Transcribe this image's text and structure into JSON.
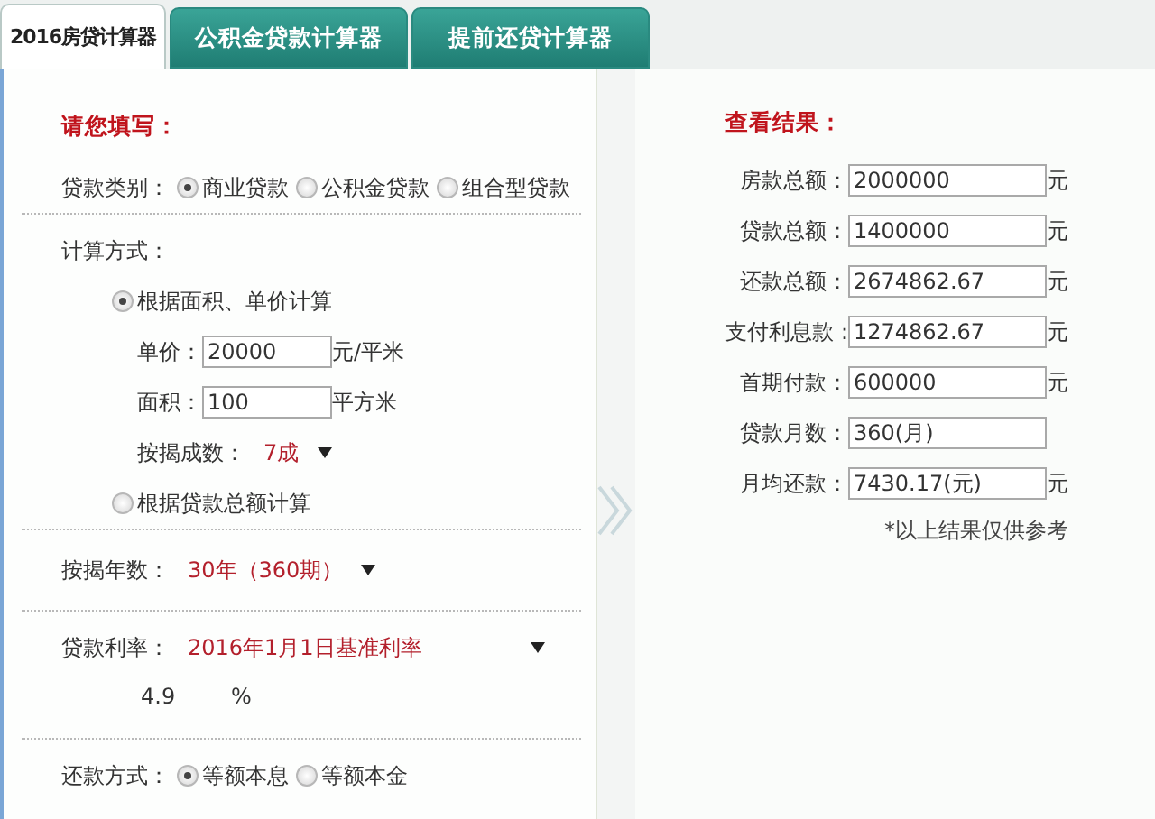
{
  "tabs": [
    {
      "label": "2016房贷计算器",
      "selected": true
    },
    {
      "label": "公积金贷款计算器",
      "selected": false
    },
    {
      "label": "提前还贷计算器",
      "selected": false
    }
  ],
  "form": {
    "heading": "请您填写：",
    "loan_type": {
      "label": "贷款类别：",
      "options": [
        {
          "label": "商业贷款",
          "selected": true
        },
        {
          "label": "公积金贷款",
          "selected": false
        },
        {
          "label": "组合型贷款",
          "selected": false
        }
      ]
    },
    "method": {
      "label": "计算方式：",
      "options": [
        {
          "label": "根据面积、单价计算",
          "selected": true,
          "fields": [
            {
              "label": "单价：",
              "value": "20000",
              "unit": "元/平米"
            },
            {
              "label": "面积：",
              "value": "100",
              "unit": "平方米"
            }
          ],
          "ratio": {
            "label": "按揭成数：",
            "value": "7成"
          }
        },
        {
          "label": "根据贷款总额计算",
          "selected": false
        }
      ]
    },
    "years": {
      "label": "按揭年数：",
      "value": "30年（360期）"
    },
    "rate": {
      "label": "贷款利率：",
      "value": "2016年1月1日基准利率",
      "rate_value": "4.9",
      "unit": "%"
    },
    "repayment": {
      "label": "还款方式：",
      "options": [
        {
          "label": "等额本息",
          "selected": true
        },
        {
          "label": "等额本金",
          "selected": false
        }
      ]
    }
  },
  "results": {
    "heading": "查看结果：",
    "rows": [
      {
        "label": "房款总额：",
        "value": "2000000",
        "unit": "元"
      },
      {
        "label": "贷款总额：",
        "value": "1400000",
        "unit": "元"
      },
      {
        "label": "还款总额：",
        "value": "2674862.67",
        "unit": "元"
      },
      {
        "label": "支付利息款：",
        "value": "1274862.67",
        "unit": "元"
      },
      {
        "label": "首期付款：",
        "value": "600000",
        "unit": "元"
      },
      {
        "label": "贷款月数：",
        "value": "360(月)"
      },
      {
        "label": "月均还款：",
        "value": "7430.17(元)",
        "unit": "元"
      }
    ],
    "note": "*以上结果仅供参考"
  }
}
